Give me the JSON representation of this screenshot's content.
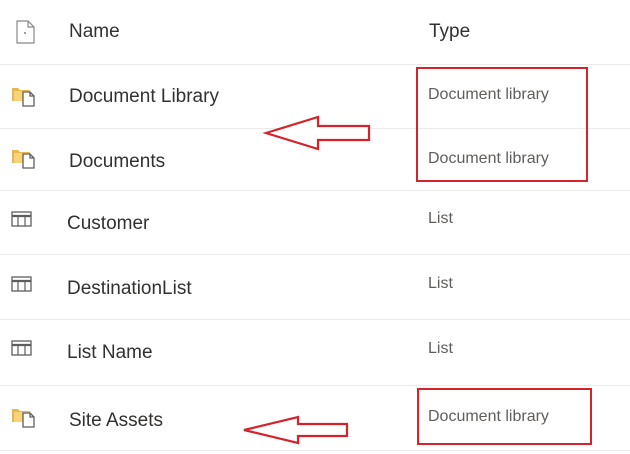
{
  "header": {
    "file_type_icon": "document-icon",
    "name_label": "Name",
    "type_label": "Type"
  },
  "rows": [
    {
      "icon": "document-library-icon",
      "name": "Document Library",
      "type": "Document library"
    },
    {
      "icon": "document-library-icon",
      "name": "Documents",
      "type": "Document library"
    },
    {
      "icon": "list-icon",
      "name": "Customer",
      "type": "List"
    },
    {
      "icon": "list-icon",
      "name": "DestinationList",
      "type": "List"
    },
    {
      "icon": "list-icon",
      "name": "List Name",
      "type": "List"
    },
    {
      "icon": "document-library-icon",
      "name": "Site Assets",
      "type": "Document library"
    }
  ],
  "annotation_color": "#d4232b",
  "library_icon_color": "#e8b84e"
}
